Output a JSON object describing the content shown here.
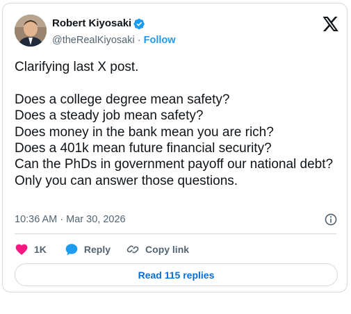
{
  "author": {
    "name": "Robert Kiyosaki",
    "handle": "@theRealKiyosaki",
    "separator": "·",
    "follow_label": "Follow"
  },
  "tweet": {
    "text": "Clarifying last X post.\n\nDoes a college degree mean safety?\nDoes a steady job mean safety?\nDoes money in the bank mean you are rich?\nDoes a 401k mean future financial security?\nCan the PhDs in government payoff our national debt?\nOnly you can answer those questions.",
    "timestamp": "10:36 AM · Mar 30, 2026"
  },
  "actions": {
    "like_count": "1K",
    "reply_label": "Reply",
    "copy_link_label": "Copy link"
  },
  "read_replies_label": "Read 115 replies",
  "colors": {
    "accent": "#1d9bf0",
    "link_blue": "#006fd6",
    "like_pink": "#f91880",
    "muted": "#536471",
    "border": "#cfd9de"
  },
  "icons": [
    "verified-badge-icon",
    "x-logo-icon",
    "info-icon",
    "heart-icon",
    "reply-bubble-icon",
    "link-icon"
  ]
}
